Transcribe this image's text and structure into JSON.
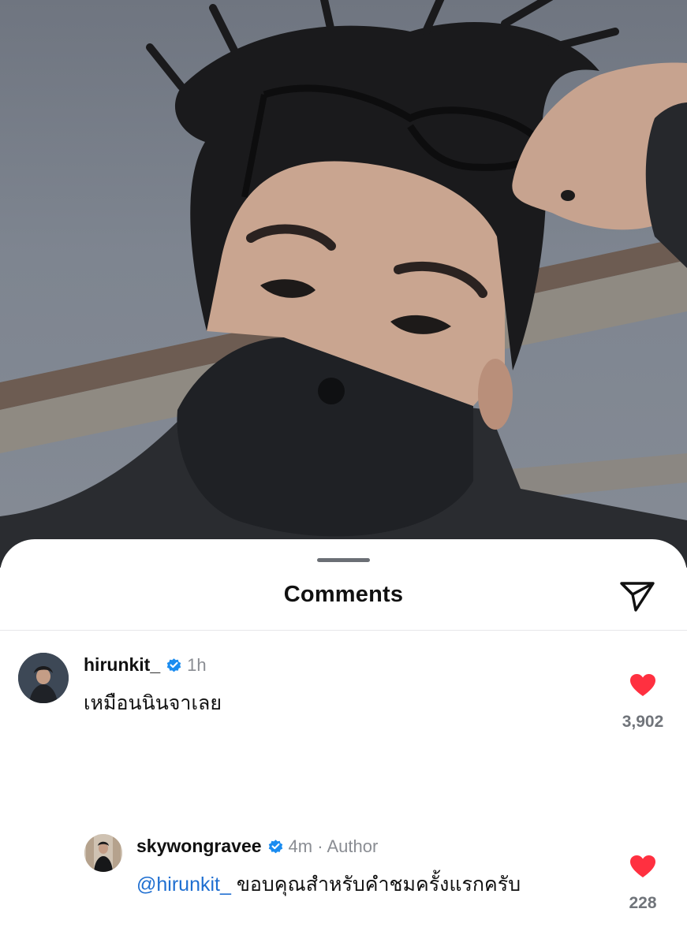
{
  "sheet": {
    "title": "Comments",
    "send_icon": "paper-plane-icon"
  },
  "comments": [
    {
      "username": "hirunkit_",
      "verified": true,
      "time": "1h",
      "text": "เหมือนนินจาเลย",
      "likes": "3,902",
      "like_icon": "heart-filled-icon",
      "like_color": "#ff3040"
    }
  ],
  "replies": [
    {
      "username": "skywongravee",
      "verified": true,
      "time": "4m",
      "separator": "·",
      "tag": "Author",
      "mention": "@hirunkit_",
      "text": "ขอบคุณสำหรับคำชมครั้งแรกครับ",
      "likes": "228",
      "like_icon": "heart-filled-icon",
      "like_color": "#ff3040"
    }
  ],
  "colors": {
    "verified_badge": "#1a8cf0",
    "mention": "#1f6fd1",
    "like": "#ff3040"
  }
}
